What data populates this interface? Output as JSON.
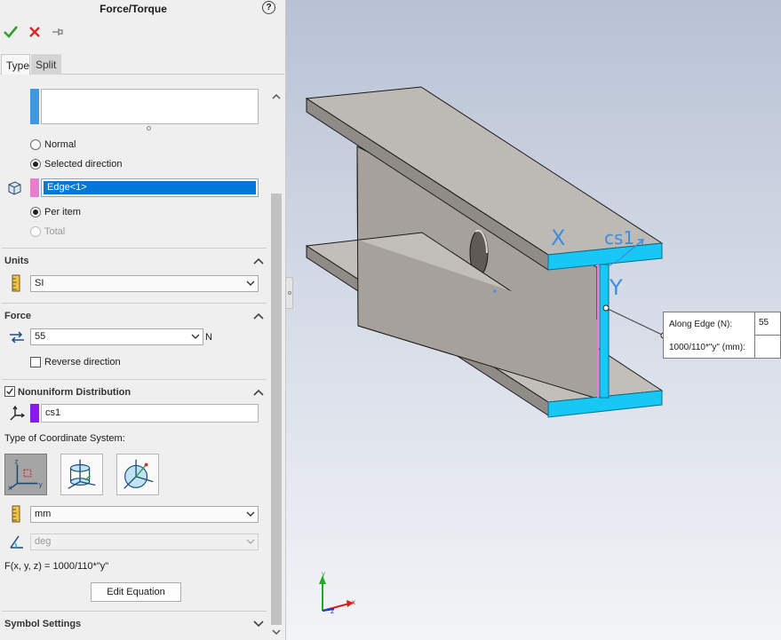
{
  "panel": {
    "title": "Force/Torque",
    "help_glyph": "?",
    "tabs": [
      {
        "label": "Type"
      },
      {
        "label": "Split"
      }
    ],
    "direction": {
      "options": [
        {
          "label": "Normal",
          "selected": false
        },
        {
          "label": "Selected direction",
          "selected": true
        }
      ],
      "direction_reference": "Edge<1>",
      "apply": [
        {
          "label": "Per item",
          "selected": true
        },
        {
          "label": "Total",
          "selected": false,
          "disabled": true
        }
      ]
    },
    "units": {
      "header": "Units",
      "system": "SI"
    },
    "force": {
      "header": "Force",
      "value": "55",
      "unit": "N",
      "reverse_label": "Reverse direction",
      "reverse_checked": false
    },
    "nonuniform": {
      "header": "Nonuniform Distribution",
      "checked": true,
      "coordinate_system": "cs1",
      "type_label": "Type of Coordinate System:",
      "length_unit": "mm",
      "angle_unit": "deg",
      "function_text": "F(x, y, z) = 1000/110*\"y\"",
      "edit_button": "Edit Equation"
    },
    "symbol_settings": {
      "header": "Symbol Settings"
    }
  },
  "viewport": {
    "callout": {
      "row1_label": "Along Edge (N):",
      "row1_value": "55",
      "row2_label": "1000/110*\"y\" (mm):"
    },
    "beam_labels": {
      "x": "X",
      "y": "Y",
      "cs": "cs1"
    },
    "triad": {
      "x": "x",
      "y": "y",
      "z": "z"
    }
  },
  "colors": {
    "accent_blue": "#0078d7",
    "selection_cyan": "#17c8f5",
    "face_pink": "#f07ad0",
    "cs_purple": "#8b19ea"
  }
}
